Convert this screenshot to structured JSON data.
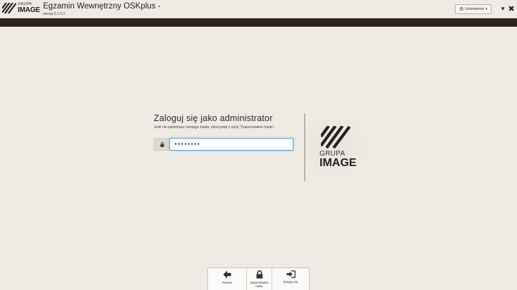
{
  "header": {
    "logo_top": "GRUPA",
    "logo_bottom": "IMAGE",
    "title": "Egzamin Wewnętrzny OSKplus -",
    "version": "wersja 6.1.2.2",
    "settings_label": "Ustawienia",
    "settings_icon": "gear-icon",
    "minimize_glyph": "▼",
    "close_glyph": "✖"
  },
  "login": {
    "title": "Zaloguj się jako administrator",
    "hint_prefix": "Jeśli nie pamiętasz swojego hasła, skorzystaj z opcji",
    "hint_option": "\"Zapomniałem hasło\".",
    "password_value": "••••••••",
    "lock_icon": "lock-icon"
  },
  "brand": {
    "grupa": "GRUPA",
    "image": "IMAGE"
  },
  "toolbar": {
    "items": [
      {
        "label": "Powrót",
        "icon": "arrow-left-icon"
      },
      {
        "label": "Zapomniałem hasło",
        "icon": "lock-icon"
      },
      {
        "label": "Zaloguj się",
        "icon": "sign-in-icon"
      }
    ]
  },
  "colors": {
    "background": "#efebe4",
    "dark_bar": "#2c251d",
    "input_focus": "#66a0d8"
  }
}
